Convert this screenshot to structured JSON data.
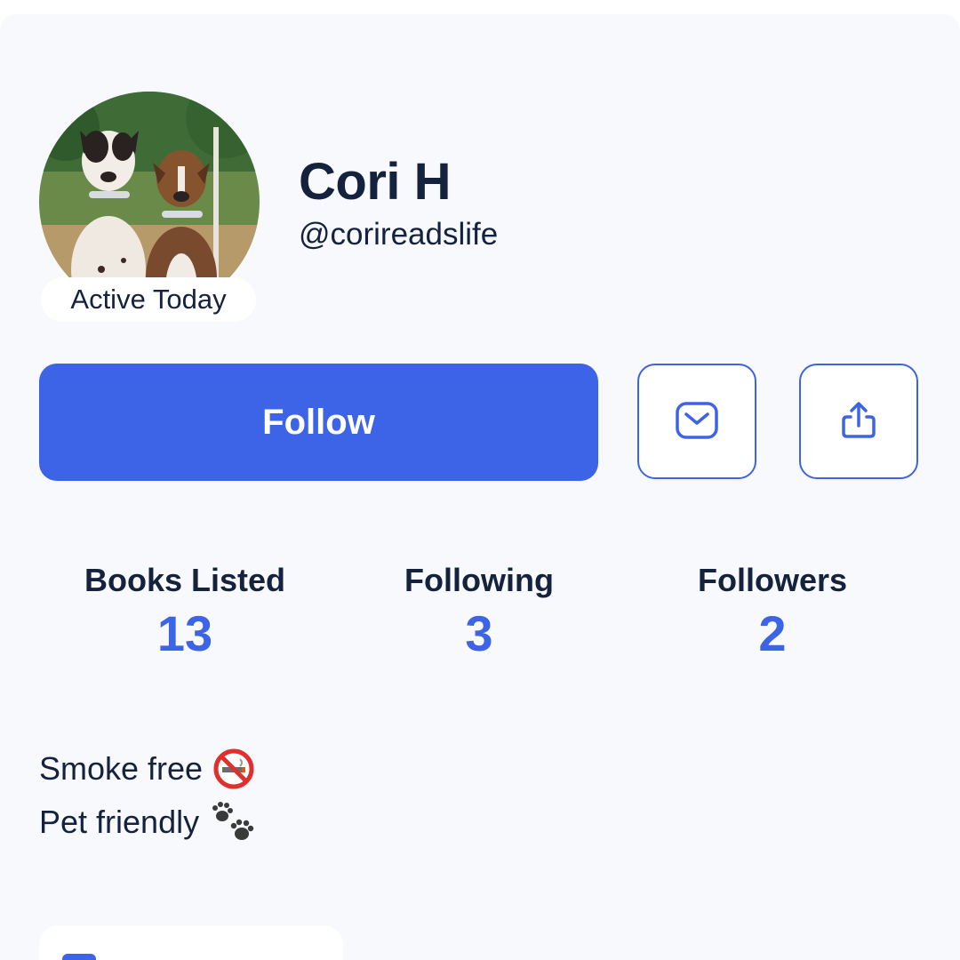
{
  "profile": {
    "name": "Cori H",
    "handle": "@corireadslife",
    "status": "Active Today",
    "avatar_icon": "profile-photo-two-dogs"
  },
  "actions": {
    "follow_label": "Follow",
    "message_icon": "envelope-icon",
    "share_icon": "share-icon"
  },
  "stats": [
    {
      "label": "Books Listed",
      "value": "13"
    },
    {
      "label": "Following",
      "value": "3"
    },
    {
      "label": "Followers",
      "value": "2"
    }
  ],
  "bio": [
    {
      "text": "Smoke free",
      "icon": "no-smoking-icon"
    },
    {
      "text": "Pet friendly",
      "icon": "paw-prints-icon"
    }
  ],
  "colors": {
    "accent": "#3d63e6",
    "text_dark": "#14223e",
    "page_bg": "#f8f9fc",
    "card_bg": "#ffffff"
  }
}
